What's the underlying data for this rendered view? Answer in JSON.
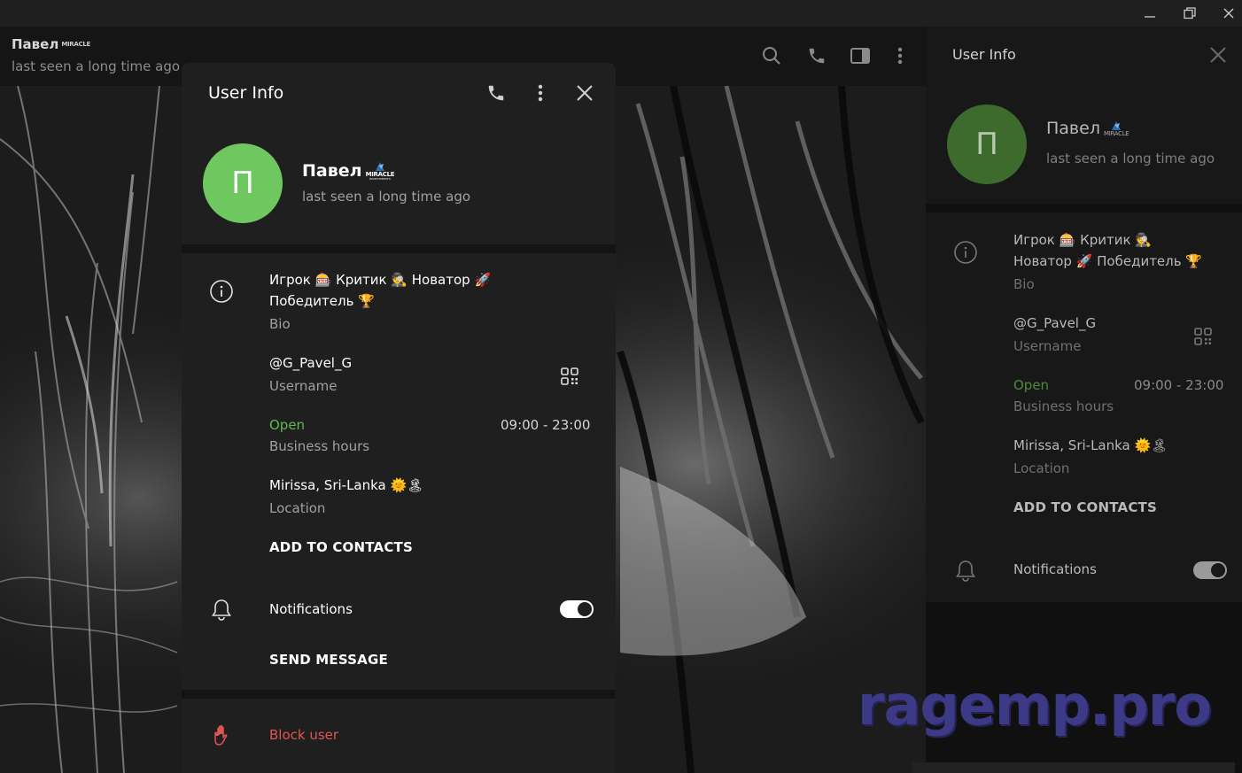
{
  "window": {
    "controls": [
      "minimize",
      "restore",
      "close"
    ]
  },
  "chat": {
    "name": "Павел",
    "status": "last seen a long time ago"
  },
  "logo": {
    "text": "MIRACLE",
    "sub": "INVESTMENTS"
  },
  "modal": {
    "title": "User Info",
    "avatar_letter": "П",
    "name": "Павел",
    "status": "last seen a long time ago",
    "bio_line1": "Игрок 🎰 Критик 🕵 Новатор 🚀",
    "bio_line2": "Победитель 🏆",
    "bio_label": "Bio",
    "username": "@G_Pavel_G",
    "username_label": "Username",
    "hours_status": "Open",
    "hours_value": "09:00 - 23:00",
    "hours_label": "Business hours",
    "location": "Mirissa, Sri-Lanka 🌞🏝",
    "location_label": "Location",
    "add_contacts": "ADD TO CONTACTS",
    "notifications": "Notifications",
    "notifications_on": true,
    "send_message": "SEND MESSAGE",
    "block_user": "Block user"
  },
  "side_panel": {
    "title": "User Info",
    "avatar_letter": "П",
    "name": "Павел",
    "status": "last seen a long time ago",
    "bio_line1": "Игрок 🎰 Критик 🕵",
    "bio_line2": "Новатор 🚀 Победитель 🏆",
    "bio_label": "Bio",
    "username": "@G_Pavel_G",
    "username_label": "Username",
    "hours_status": "Open",
    "hours_value": "09:00 - 23:00",
    "hours_label": "Business hours",
    "location": "Mirissa, Sri-Lanka 🌞🏝",
    "location_label": "Location",
    "add_contacts": "ADD TO CONTACTS",
    "notifications": "Notifications",
    "notifications_on": true
  },
  "watermark": "ragemp.pro",
  "colors": {
    "accent_green": "#5fb94e",
    "avatar_green": "#6fc85f",
    "danger": "#e05453",
    "watermark": "#3c3a86"
  }
}
